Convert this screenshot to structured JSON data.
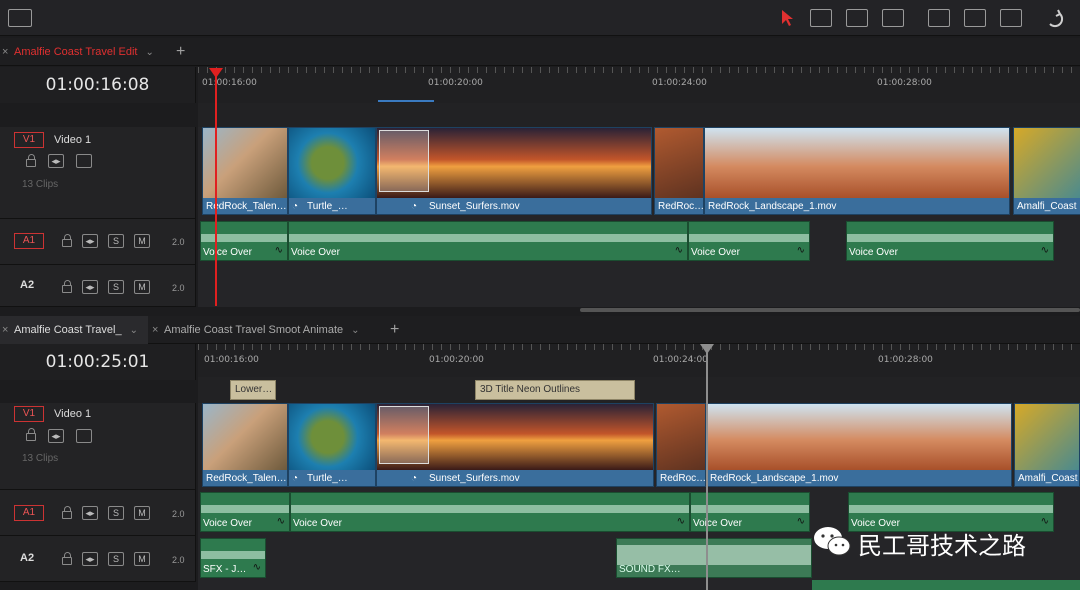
{
  "toolbar": {
    "icons": [
      "layout-icon",
      "select-arrow-icon",
      "trim-icon",
      "dynamic-trim-icon",
      "blade-icon",
      "insert-icon",
      "overwrite-icon",
      "replace-icon",
      "snap-icon"
    ]
  },
  "timeline1": {
    "tab_label": "Amalfie Coast Travel Edit",
    "timecode": "01:00:16:08",
    "ruler": [
      "01:00:16:00",
      "01:00:20:00",
      "01:00:24:00",
      "01:00:28:00"
    ],
    "tracks": {
      "v1": {
        "id": "V1",
        "name": "Video 1",
        "clips_count": "13 Clips"
      },
      "a1": {
        "id": "A1",
        "vol": "2.0",
        "S": "S",
        "M": "M"
      },
      "a2": {
        "id": "A2",
        "vol": "2.0",
        "S": "S",
        "M": "M"
      }
    },
    "video_clips": [
      "RedRock_Talen…",
      "Turtle_…",
      "Sunset_Surfers.mov",
      "RedRoc…",
      "RedRock_Landscape_1.mov",
      "Amalfi_Coast"
    ],
    "audio_clips": [
      "Voice Over",
      "Voice Over",
      "Voice Over",
      "Voice Over"
    ]
  },
  "timeline2": {
    "tabs": [
      "Amalfie Coast Travel_",
      "Amalfie Coast Travel Smoot Animate"
    ],
    "timecode": "01:00:25:01",
    "ruler": [
      "01:00:16:00",
      "01:00:20:00",
      "01:00:24:00",
      "01:00:28:00"
    ],
    "title_clips": [
      "Lower…",
      "3D Title Neon Outlines"
    ],
    "tracks": {
      "v1": {
        "id": "V1",
        "name": "Video 1",
        "clips_count": "13 Clips"
      },
      "a1": {
        "id": "A1",
        "vol": "2.0",
        "S": "S",
        "M": "M"
      },
      "a2": {
        "id": "A2",
        "vol": "2.0",
        "S": "S",
        "M": "M"
      }
    },
    "video_clips": [
      "RedRock_Talen…",
      "Turtle_…",
      "Sunset_Surfers.mov",
      "RedRoc…",
      "RedRock_Landscape_1.mov",
      "Amalfi_Coast"
    ],
    "audio_clips": [
      "Voice Over",
      "Voice Over",
      "Voice Over",
      "Voice Over",
      "SFX - J…",
      "SOUND FX…"
    ]
  },
  "watermark": "民工哥技术之路",
  "colors": {
    "accent_red": "#e02020",
    "video_clip": "#3a6e9c",
    "audio_clip": "#2e7a4e",
    "title_clip": "#c9bf9e"
  }
}
